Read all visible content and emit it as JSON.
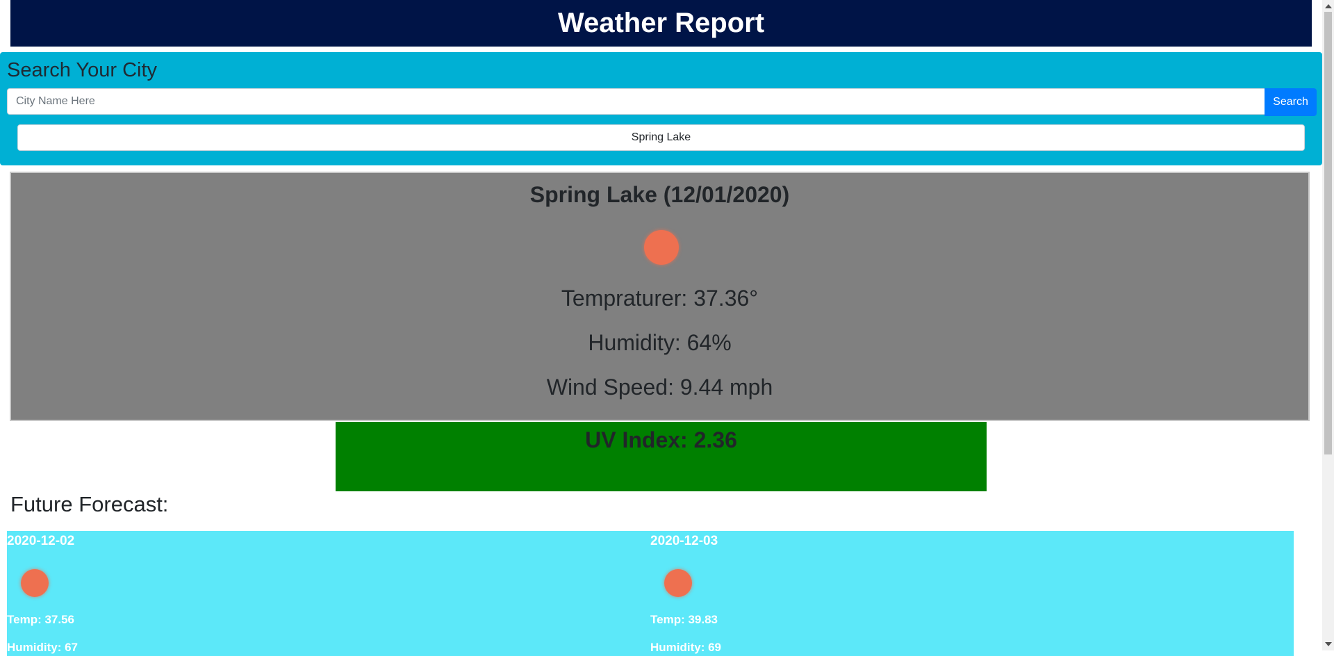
{
  "header": {
    "title": "Weather Report"
  },
  "search": {
    "title": "Search Your City",
    "placeholder": "City Name Here",
    "value": "",
    "button_label": "Search",
    "history": [
      "Spring Lake"
    ]
  },
  "current": {
    "title": "Spring Lake (12/01/2020)",
    "icon": "weather-condition-icon",
    "temperature": "Tempraturer: 37.36°",
    "humidity": "Humidity: 64%",
    "wind": "Wind Speed: 9.44 mph",
    "uv": "UV Index: 2.36"
  },
  "forecast": {
    "heading": "Future Forecast:",
    "days": [
      {
        "date": "2020-12-02",
        "icon": "weather-condition-icon",
        "temp": "Temp: 37.56",
        "humidity": "Humidity: 67"
      },
      {
        "date": "2020-12-03",
        "icon": "weather-condition-icon",
        "temp": "Temp: 39.83",
        "humidity": "Humidity: 69"
      }
    ]
  },
  "colors": {
    "header_bg": "#001447",
    "search_panel_bg": "#00b0d4",
    "search_button_bg": "#007bff",
    "current_bg": "#808080",
    "uv_bg": "#008000",
    "forecast_card_bg": "#5ce8f9",
    "icon_color": "#ee7050"
  }
}
